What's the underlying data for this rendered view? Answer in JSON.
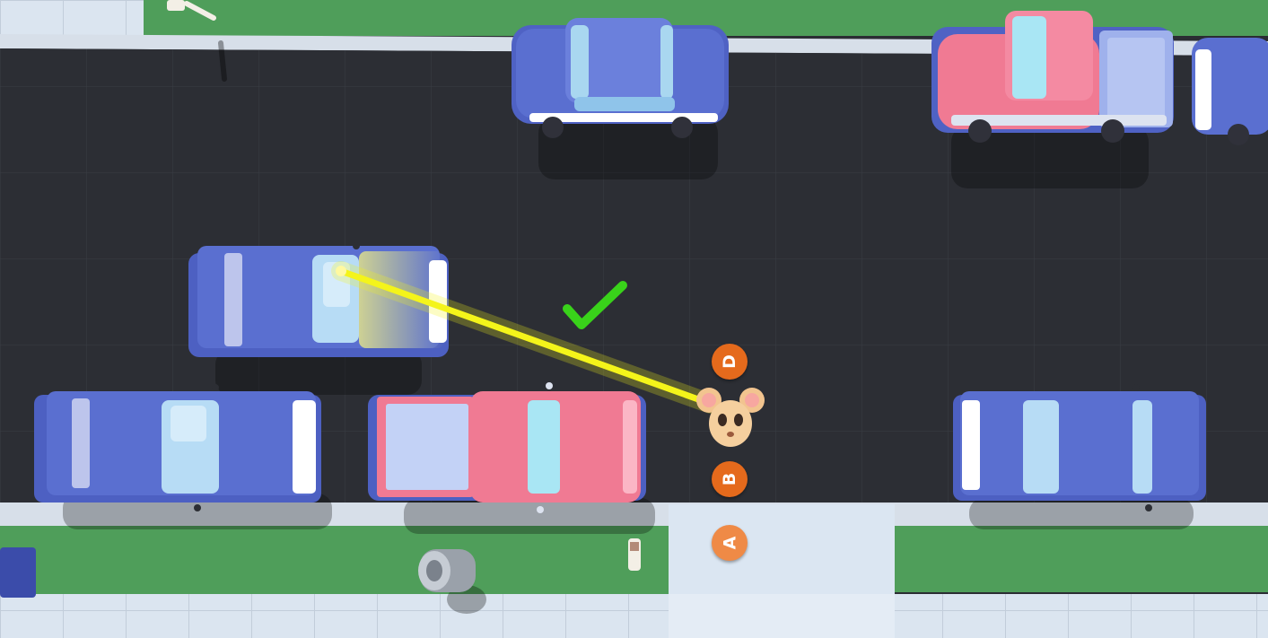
{
  "colors": {
    "road": "#2c2e34",
    "grass": "#4f9e5a",
    "sidewalk": "#d9e3ef",
    "blue_car": "#5a6fd0",
    "red_truck": "#f07a93",
    "marker_orange": "#e56a1c",
    "line_yellow": "#f4f41a",
    "check_green": "#39d21a"
  },
  "markers": [
    {
      "id": "D",
      "label": "D"
    },
    {
      "id": "B",
      "label": "B"
    },
    {
      "id": "A",
      "label": "A"
    }
  ],
  "player": {
    "character": "mouse-face",
    "status": "linked-to-car"
  },
  "check_icon": "check-icon"
}
